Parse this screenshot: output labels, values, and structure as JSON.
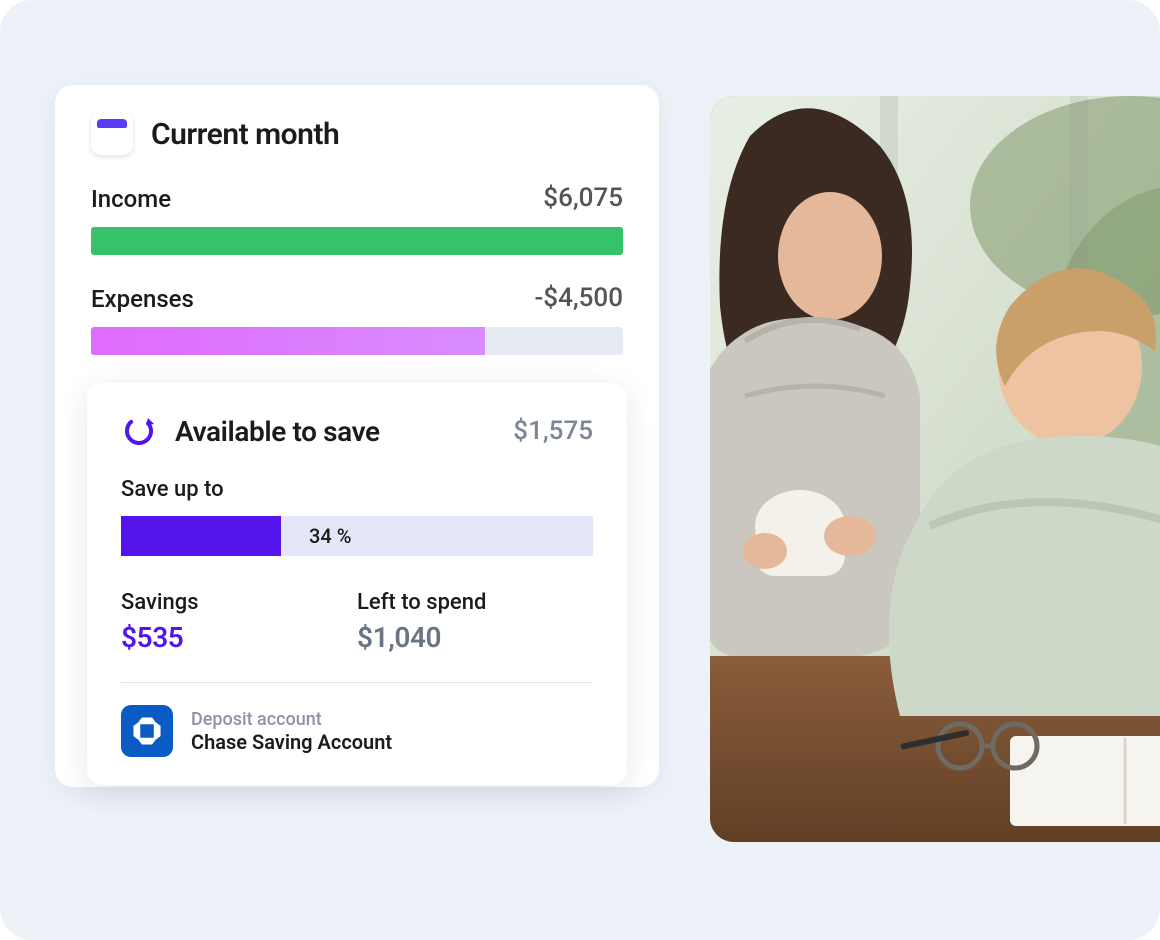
{
  "card": {
    "title": "Current month",
    "income": {
      "label": "Income",
      "amount": "$6,075",
      "bar_pct": 100
    },
    "expenses": {
      "label": "Expenses",
      "amount": "-$4,500",
      "bar_pct": 74
    }
  },
  "available": {
    "title": "Available to save",
    "amount": "$1,575",
    "save_up_label": "Save up to",
    "save_pct_label": "34 %",
    "save_pct": 34,
    "savings": {
      "label": "Savings",
      "amount": "$535"
    },
    "left": {
      "label": "Left to spend",
      "amount": "$1,040"
    }
  },
  "deposit": {
    "small": "Deposit account",
    "big": "Chase Saving Account"
  },
  "colors": {
    "income_bar": "#36c26b",
    "expense_bar": "#d88cff",
    "accent": "#5315ec",
    "bank": "#0a5bc4"
  }
}
